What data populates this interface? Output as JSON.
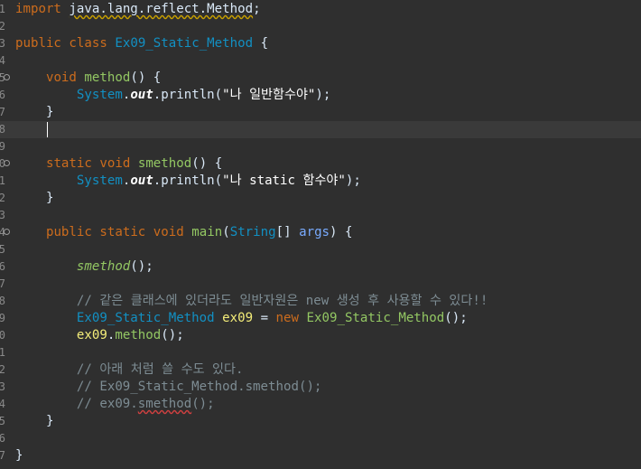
{
  "editor": {
    "line_numbers": [
      "1",
      "2",
      "3",
      "4",
      "5",
      "6",
      "7",
      "8",
      "9",
      "0",
      "1",
      "2",
      "3",
      "4",
      "5",
      "6",
      "7",
      "8",
      "9",
      "0",
      "1",
      "2",
      "3",
      "4",
      "5",
      "6",
      "7"
    ],
    "lines": [
      {
        "segments": [
          [
            "kw",
            "import"
          ],
          [
            "pl",
            " "
          ],
          [
            "uline",
            "java.lang.reflect.Method"
          ],
          [
            "pl",
            ";"
          ]
        ]
      },
      {
        "segments": []
      },
      {
        "segments": [
          [
            "kw",
            "public"
          ],
          [
            "pl",
            " "
          ],
          [
            "kw",
            "class"
          ],
          [
            "pl",
            " "
          ],
          [
            "cls",
            "Ex09_Static_Method"
          ],
          [
            "pl",
            " {"
          ]
        ]
      },
      {
        "segments": []
      },
      {
        "fold": true,
        "segments": [
          [
            "pl",
            "    "
          ],
          [
            "kw",
            "void"
          ],
          [
            "pl",
            " "
          ],
          [
            "fn",
            "method"
          ],
          [
            "pl",
            "() {"
          ]
        ]
      },
      {
        "segments": [
          [
            "pl",
            "        "
          ],
          [
            "ty",
            "System"
          ],
          [
            "pl",
            "."
          ],
          [
            "fld",
            "out"
          ],
          [
            "pl",
            ".println("
          ],
          [
            "str",
            "\"나 일반함수야\""
          ],
          [
            "pl",
            ");"
          ]
        ]
      },
      {
        "segments": [
          [
            "pl",
            "    }"
          ]
        ]
      },
      {
        "current": true,
        "segments": []
      },
      {
        "segments": []
      },
      {
        "fold": true,
        "segments": [
          [
            "pl",
            "    "
          ],
          [
            "kw",
            "static"
          ],
          [
            "pl",
            " "
          ],
          [
            "kw",
            "void"
          ],
          [
            "pl",
            " "
          ],
          [
            "fn",
            "smethod"
          ],
          [
            "pl",
            "() {"
          ]
        ]
      },
      {
        "segments": [
          [
            "pl",
            "        "
          ],
          [
            "ty",
            "System"
          ],
          [
            "pl",
            "."
          ],
          [
            "fld",
            "out"
          ],
          [
            "pl",
            ".println("
          ],
          [
            "str",
            "\"나 static 함수야\""
          ],
          [
            "pl",
            ");"
          ]
        ]
      },
      {
        "segments": [
          [
            "pl",
            "    }"
          ]
        ]
      },
      {
        "segments": []
      },
      {
        "fold": true,
        "segments": [
          [
            "pl",
            "    "
          ],
          [
            "kw",
            "public"
          ],
          [
            "pl",
            " "
          ],
          [
            "kw",
            "static"
          ],
          [
            "pl",
            " "
          ],
          [
            "kw",
            "void"
          ],
          [
            "pl",
            " "
          ],
          [
            "fn",
            "main"
          ],
          [
            "pl",
            "("
          ],
          [
            "ty",
            "String"
          ],
          [
            "pl",
            "[] "
          ],
          [
            "param",
            "args"
          ],
          [
            "pl",
            ") {"
          ]
        ]
      },
      {
        "segments": []
      },
      {
        "segments": [
          [
            "pl",
            "        "
          ],
          [
            "smethod",
            "smethod"
          ],
          [
            "pl",
            "();"
          ]
        ]
      },
      {
        "segments": []
      },
      {
        "segments": [
          [
            "pl",
            "        "
          ],
          [
            "cm",
            "// 같은 클래스에 있더라도 일반자원은 new 생성 후 사용할 수 있다!!"
          ]
        ]
      },
      {
        "segments": [
          [
            "pl",
            "        "
          ],
          [
            "cls",
            "Ex09_Static_Method"
          ],
          [
            "pl",
            " "
          ],
          [
            "local",
            "ex09"
          ],
          [
            "pl",
            " = "
          ],
          [
            "kw",
            "new"
          ],
          [
            "pl",
            " "
          ],
          [
            "fn",
            "Ex09_Static_Method"
          ],
          [
            "pl",
            "();"
          ]
        ]
      },
      {
        "segments": [
          [
            "pl",
            "        "
          ],
          [
            "local",
            "ex09"
          ],
          [
            "pl",
            "."
          ],
          [
            "fn",
            "method"
          ],
          [
            "pl",
            "();"
          ]
        ]
      },
      {
        "segments": []
      },
      {
        "segments": [
          [
            "pl",
            "        "
          ],
          [
            "cm",
            "// 아래 처럼 쓸 수도 있다."
          ]
        ]
      },
      {
        "segments": [
          [
            "pl",
            "        "
          ],
          [
            "cm",
            "// Ex09_Static_Method.smethod();"
          ]
        ]
      },
      {
        "segments": [
          [
            "pl",
            "        "
          ],
          [
            "cm",
            "// ex09."
          ],
          [
            "cmu",
            "smethod"
          ],
          [
            "cm",
            "();"
          ]
        ]
      },
      {
        "segments": [
          [
            "pl",
            "    }"
          ]
        ]
      },
      {
        "segments": []
      },
      {
        "segments": [
          [
            "pl",
            "}"
          ]
        ]
      }
    ],
    "fold_glyph": "⊖"
  }
}
